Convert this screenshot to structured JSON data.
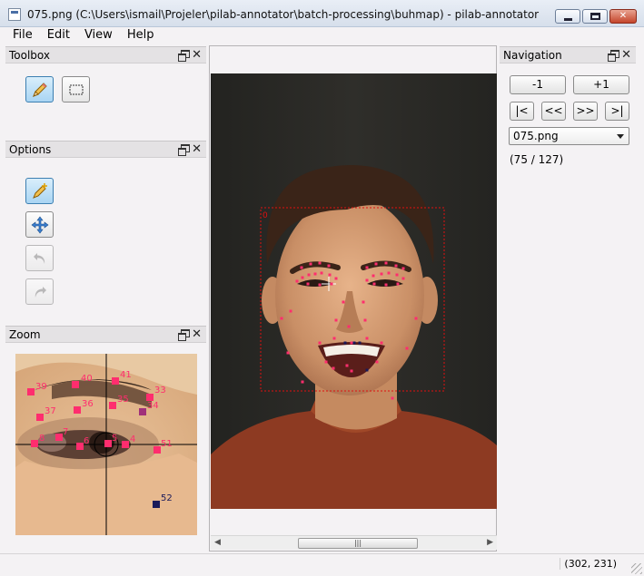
{
  "window": {
    "title": "075.png (C:\\Users\\ismail\\Projeler\\pilab-annotator\\batch-processing\\buhmap) - pilab-annotator"
  },
  "menu": [
    "File",
    "Edit",
    "View",
    "Help"
  ],
  "toolbox": {
    "title": "Toolbox",
    "tools": [
      {
        "name": "pencil-tool",
        "icon": "pencil-icon",
        "active": true
      },
      {
        "name": "rectangle-select-tool",
        "icon": "rectangle-icon",
        "active": false
      }
    ]
  },
  "options": {
    "title": "Options",
    "buttons": [
      {
        "name": "add-point-button",
        "icon": "pencil-plus-icon",
        "active": true,
        "enabled": true
      },
      {
        "name": "move-point-button",
        "icon": "move-arrows-icon",
        "active": false,
        "enabled": true
      },
      {
        "name": "undo-button",
        "icon": "undo-icon",
        "active": false,
        "enabled": false
      },
      {
        "name": "redo-button",
        "icon": "redo-icon",
        "active": false,
        "enabled": false
      }
    ]
  },
  "zoom": {
    "title": "Zoom",
    "labels": [
      "39",
      "40",
      "41",
      "33",
      "37",
      "36",
      "35",
      "34",
      "8",
      "7",
      "6",
      "5",
      "4",
      "51",
      "52"
    ]
  },
  "image": {
    "bbox_label": "0"
  },
  "navigation": {
    "title": "Navigation",
    "prev_label": "-1",
    "next_label": "+1",
    "first_label": "|<",
    "back_label": "<<",
    "forward_label": ">>",
    "last_label": ">|",
    "selected_file": "075.png",
    "counter": "(75 / 127)"
  },
  "status": {
    "coords": "(302, 231)"
  },
  "colors": {
    "landmark": "#ff2d6e",
    "landmark_dark": "#1a1a5a",
    "bbox": "#e01010"
  }
}
